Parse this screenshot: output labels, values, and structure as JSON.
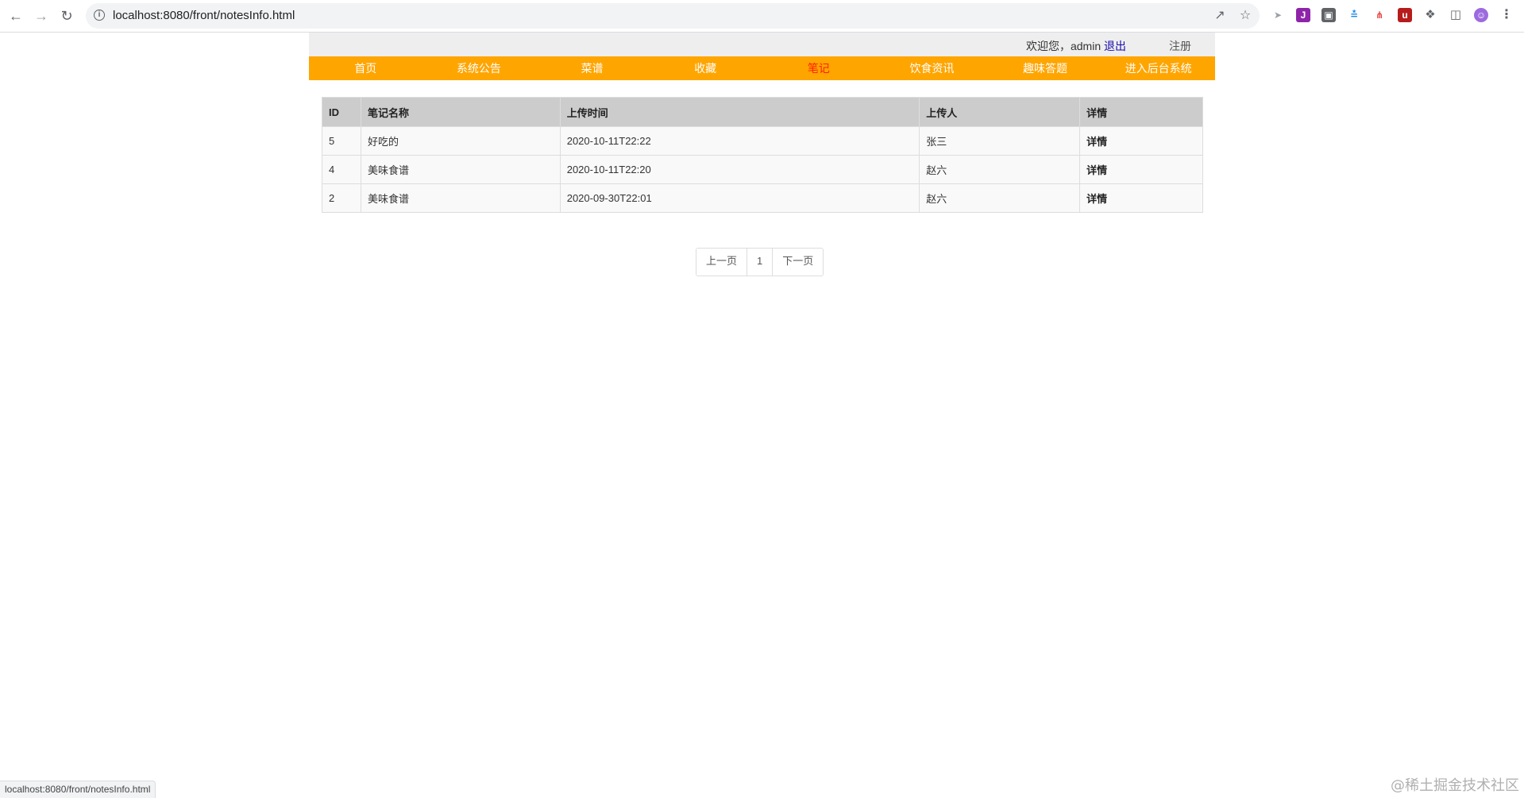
{
  "browser": {
    "url": "localhost:8080/front/notesInfo.html",
    "status_url": "localhost:8080/front/notesInfo.html"
  },
  "topbar": {
    "welcome": "欢迎您，admin",
    "logout": "退出",
    "register": "注册"
  },
  "menu": [
    {
      "label": "首页"
    },
    {
      "label": "系统公告"
    },
    {
      "label": "菜谱"
    },
    {
      "label": "收藏"
    },
    {
      "label": "笔记",
      "active": true
    },
    {
      "label": "饮食资讯"
    },
    {
      "label": "趣味答题"
    },
    {
      "label": "进入后台系统"
    }
  ],
  "table": {
    "headers": [
      "ID",
      "笔记名称",
      "上传时间",
      "上传人",
      "详情"
    ],
    "rows": [
      [
        "5",
        "好吃的",
        "2020-10-11T22:22",
        "张三",
        "详情"
      ],
      [
        "4",
        "美味食谱",
        "2020-10-11T22:20",
        "赵六",
        "详情"
      ],
      [
        "2",
        "美味食谱",
        "2020-09-30T22:01",
        "赵六",
        "详情"
      ]
    ]
  },
  "pager": {
    "prev": "上一页",
    "current": "1",
    "next": "下一页"
  },
  "watermark": "@稀土掘金技术社区",
  "colors": {
    "menu_bg": "#ffa500",
    "menu_active": "#ff1f00",
    "topbar_bg": "#eeeeee",
    "header_bg": "#cccccc"
  }
}
